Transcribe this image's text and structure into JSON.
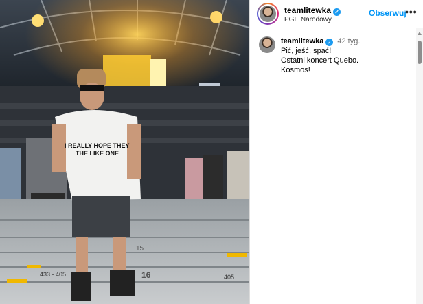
{
  "post": {
    "username": "teamlitewka",
    "location": "PGE Narodowy",
    "follow_label": "Obserwuj",
    "more_label": "•••",
    "verified_glyph": "✓",
    "caption": {
      "username": "teamlitewka",
      "time": "42 tyg.",
      "lines": [
        "Pić, jeść, spać!",
        "Ostatni koncert Quebo.",
        "Kosmos!"
      ]
    }
  },
  "photo": {
    "shirt_text_line1": "I REALLY HOPE THEY",
    "shirt_text_line2": "THE LIKE ONE",
    "step_numbers": [
      "15",
      "16"
    ],
    "seat_labels": [
      "433 - 405",
      "405"
    ]
  },
  "colors": {
    "accent": "#0095f6",
    "verified": "#1d9bf0"
  },
  "icons": [
    "verified-icon",
    "more-options-icon"
  ]
}
